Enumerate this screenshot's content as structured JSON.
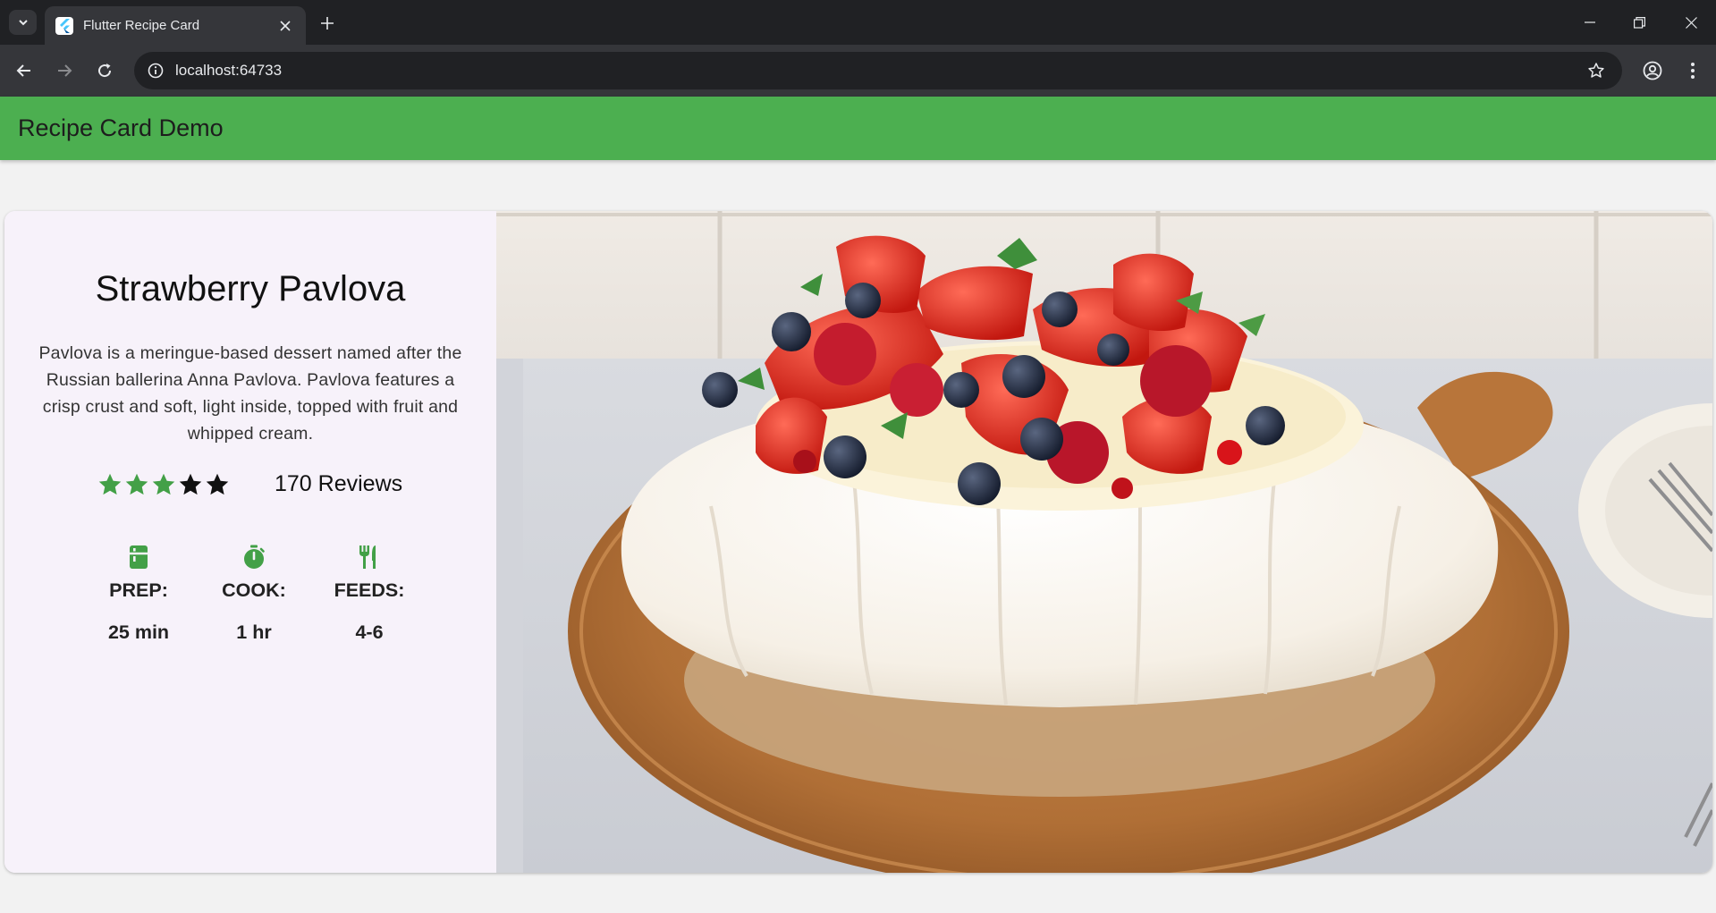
{
  "browser": {
    "tab_title": "Flutter Recipe Card",
    "url": "localhost:64733"
  },
  "app": {
    "title": "Recipe Card Demo"
  },
  "recipe": {
    "title": "Strawberry Pavlova",
    "description": "Pavlova is a meringue-based dessert named after the Russian ballerina Anna Pavlova. Pavlova features a crisp crust and soft, light inside, topped with fruit and whipped cream.",
    "rating": 3,
    "rating_max": 5,
    "reviews": "170 Reviews",
    "stats": [
      {
        "icon": "kitchen-icon",
        "label": "PREP:",
        "value": "25 min"
      },
      {
        "icon": "timer-icon",
        "label": "COOK:",
        "value": "1 hr"
      },
      {
        "icon": "restaurant-icon",
        "label": "FEEDS:",
        "value": "4-6"
      }
    ]
  },
  "colors": {
    "accent": "#4caf50",
    "icon_green": "#43a047",
    "star_filled": "#43a047",
    "star_empty": "#111111"
  }
}
